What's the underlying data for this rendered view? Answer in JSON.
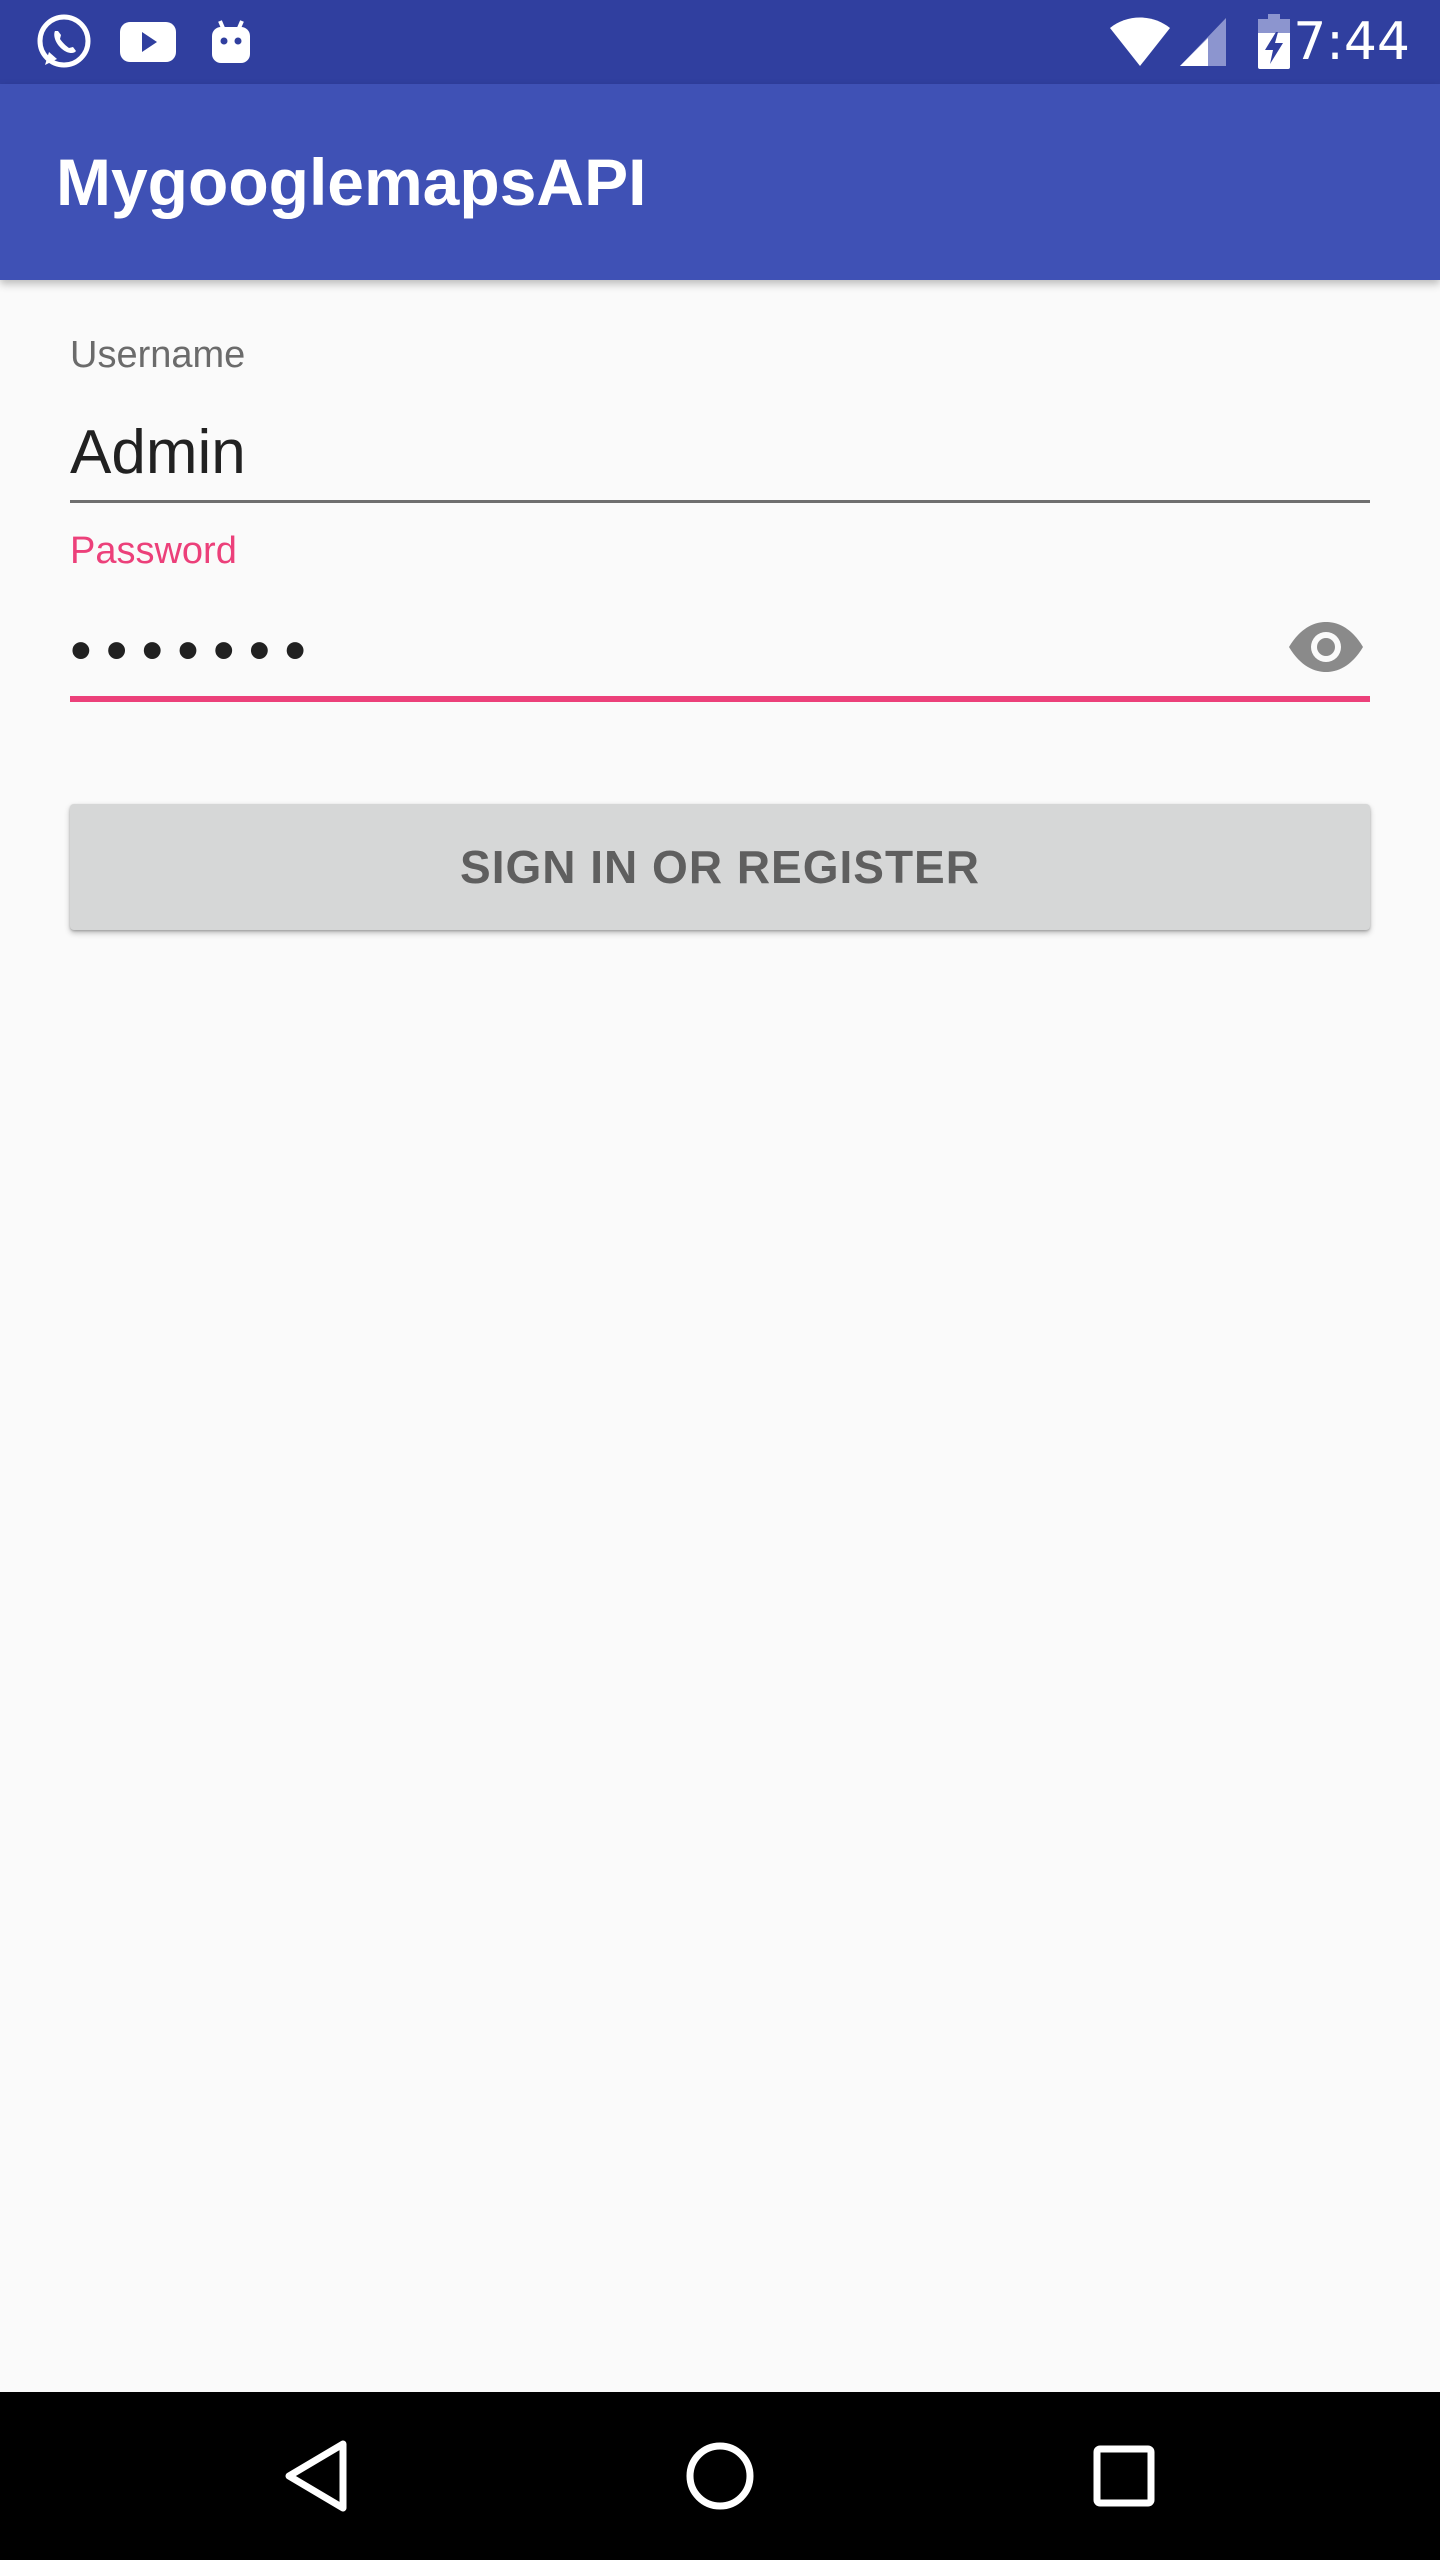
{
  "status_bar": {
    "time": "7:44",
    "left_icons": [
      "whatsapp-icon",
      "youtube-icon",
      "android-icon"
    ],
    "right_icons": [
      "wifi-icon",
      "signal-icon",
      "battery-charging-icon"
    ]
  },
  "app_bar": {
    "title": "MygooglemapsAPI"
  },
  "form": {
    "username": {
      "label": "Username",
      "value": "Admin"
    },
    "password": {
      "label": "Password",
      "value": "•••••••"
    },
    "submit_label": "SIGN IN OR REGISTER"
  },
  "nav_bar": {
    "buttons": [
      "back-icon",
      "home-icon",
      "recents-icon"
    ]
  },
  "colors": {
    "status_bar": "#303F9F",
    "app_bar": "#3F51B5",
    "accent": "#EC407A",
    "background": "#FAFAFA",
    "button": "#D6D7D7"
  }
}
